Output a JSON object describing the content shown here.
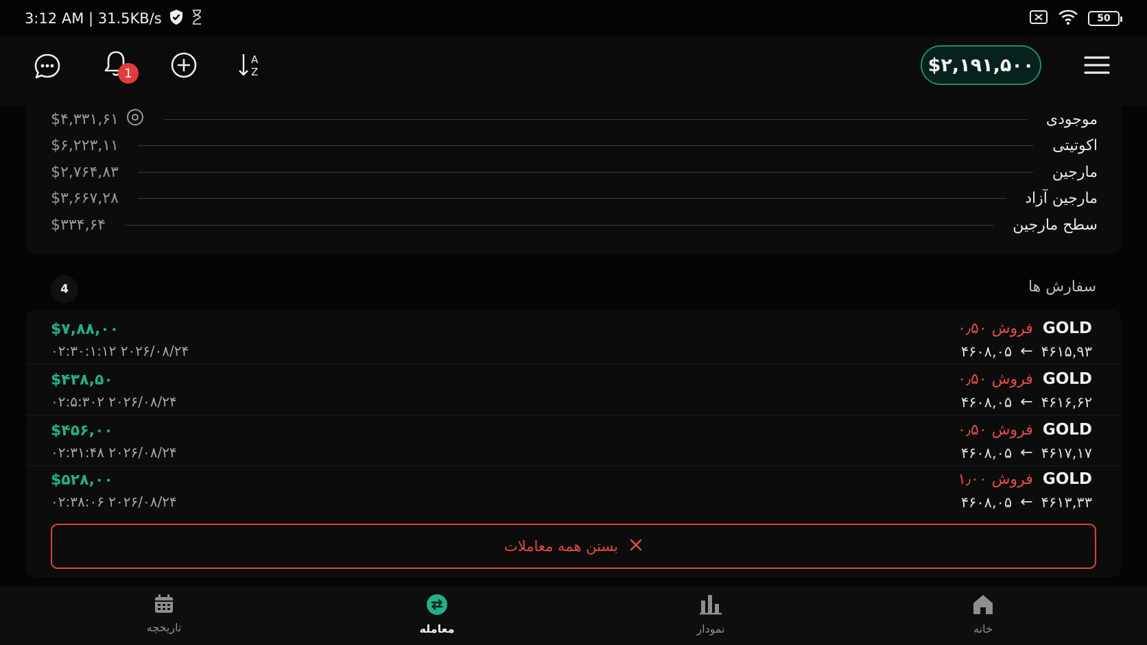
{
  "status_bar": {
    "time_speed": "3:12 AM | 31.5KB/s",
    "battery": "50"
  },
  "header": {
    "notification_count": "1",
    "balance": "$۲,۱۹۱,۵۰۰"
  },
  "account": {
    "rows": [
      {
        "label": "موجودی",
        "value": "$۴,۳۳۱,۶۱"
      },
      {
        "label": "اکوتیتی",
        "value": "$۶,۲۲۳,۱۱"
      },
      {
        "label": "مارجین",
        "value": "$۲,۷۶۴,۸۳"
      },
      {
        "label": "مارجین آزاد",
        "value": "$۳,۶۶۷,۲۸"
      },
      {
        "label": "سطح مارجین",
        "value": "$۳۳۴,۶۴"
      }
    ]
  },
  "orders": {
    "title": "سفارش ها",
    "count": "4",
    "items": [
      {
        "symbol": "GOLD",
        "type": "فروش ۰٫۵۰",
        "open_price": "۴۶۱۵,۹۳",
        "current_price": "۴۶۰۸,۰۵",
        "profit": "$۷,۸۸,۰۰",
        "time": "۰۲:۳۰:۱:۱۲ ۲۰۲۶/۰۸/۲۴"
      },
      {
        "symbol": "GOLD",
        "type": "فروش ۰٫۵۰",
        "open_price": "۴۶۱۶,۶۲",
        "current_price": "۴۶۰۸,۰۵",
        "profit": "$۴۳۸,۵۰",
        "time": "۰۲:۵:۳۰۲ ۲۰۲۶/۰۸/۲۴"
      },
      {
        "symbol": "GOLD",
        "type": "فروش ۰٫۵۰",
        "open_price": "۴۶۱۷,۱۷",
        "current_price": "۴۶۰۸,۰۵",
        "profit": "$۴۵۶,۰۰",
        "time": "۰۲:۳۱:۴۸ ۲۰۲۶/۰۸/۲۴"
      },
      {
        "symbol": "GOLD",
        "type": "فروش ۱٫۰۰",
        "open_price": "۴۶۱۳,۳۳",
        "current_price": "۴۶۰۸,۰۵",
        "profit": "$۵۲۸,۰۰",
        "time": "۰۲:۳۸:۰۶ ۲۰۲۶/۰۸/۲۴"
      }
    ],
    "close_all_label": "بستن همه معاملات"
  },
  "bottom_nav": [
    {
      "label": "تاریخچه",
      "icon": "calendar-icon"
    },
    {
      "label": "معامله",
      "icon": "trade-swap-icon"
    },
    {
      "label": "نمودار",
      "icon": "bar-chart-icon"
    },
    {
      "label": "خانه",
      "icon": "home-icon"
    }
  ],
  "colors": {
    "profit_green": "#22b08a",
    "sell_red": "#e64b4b",
    "accent_teal": "#1f8a6f"
  }
}
